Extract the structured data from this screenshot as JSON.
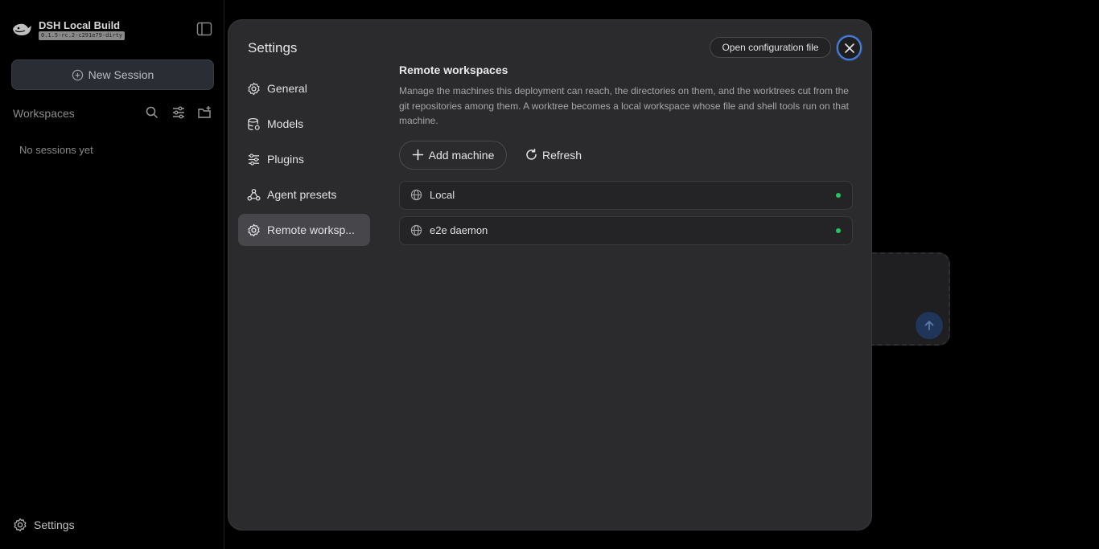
{
  "sidebar": {
    "brand_name": "DSH Local Build",
    "brand_version": "0.1.5-rc.2-c291e79-dirty",
    "new_session_label": "New Session",
    "workspaces_title": "Workspaces",
    "empty_label": "No sessions yet",
    "settings_label": "Settings"
  },
  "modal": {
    "title": "Settings",
    "open_config_label": "Open configuration file",
    "nav": [
      {
        "label": "General",
        "icon": "gear-icon"
      },
      {
        "label": "Models",
        "icon": "database-icon"
      },
      {
        "label": "Plugins",
        "icon": "sliders-icon"
      },
      {
        "label": "Agent presets",
        "icon": "agents-icon"
      },
      {
        "label": "Remote worksp...",
        "icon": "gear-icon",
        "active": true
      }
    ],
    "section": {
      "title": "Remote workspaces",
      "description": "Manage the machines this deployment can reach, the directories on them, and the worktrees cut from the git repositories among them. A worktree becomes a local workspace whose file and shell tools run on that machine.",
      "add_machine_label": "Add machine",
      "refresh_label": "Refresh",
      "machines": [
        {
          "name": "Local",
          "status": "online"
        },
        {
          "name": "e2e daemon",
          "status": "online"
        }
      ]
    }
  },
  "colors": {
    "accent": "#4a7dd6",
    "status_online": "#22c55e",
    "modal_bg": "#2b2b2e",
    "active_nav_bg": "#46464b"
  }
}
